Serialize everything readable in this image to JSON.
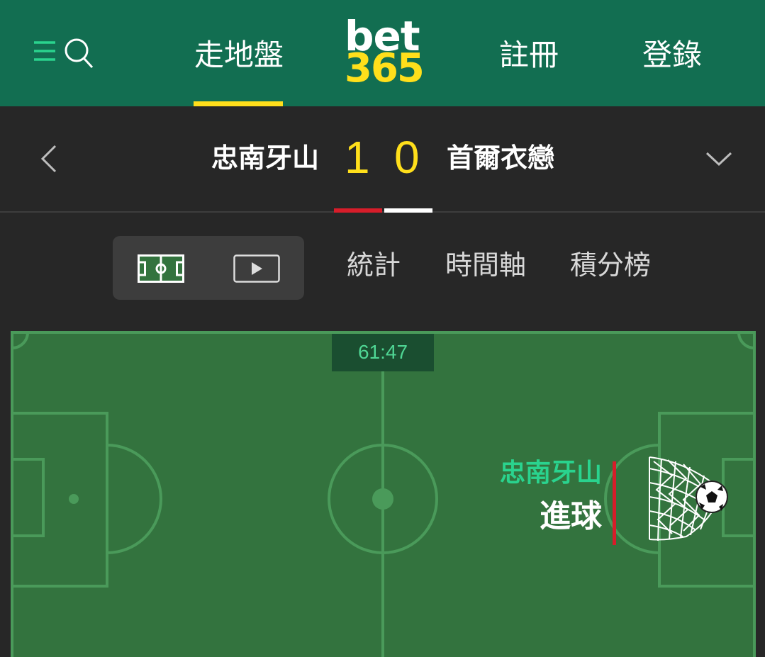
{
  "header": {
    "nav": {
      "live_label": "走地盤",
      "register_label": "註冊",
      "login_label": "登錄"
    },
    "logo": {
      "top": "bet",
      "bottom": "365"
    },
    "colors": {
      "brand_green": "#126e51",
      "accent_yellow": "#ffdf1b"
    }
  },
  "match": {
    "home_team": "忠南牙山",
    "away_team": "首爾衣戀",
    "home_score": "1",
    "away_score": "0",
    "home_color": "#d71d2a",
    "away_color": "#ffffff"
  },
  "view_tabs": {
    "icons": [
      "pitch-icon",
      "play-icon"
    ],
    "stats_label": "統計",
    "timeline_label": "時間軸",
    "standings_label": "積分榜"
  },
  "pitch": {
    "clock": "61:47",
    "event_team": "忠南牙山",
    "event_type": "進球",
    "colors": {
      "grass": "#33733e",
      "lines": "#4a9a5a",
      "event_team_text": "#2ad38e"
    }
  }
}
